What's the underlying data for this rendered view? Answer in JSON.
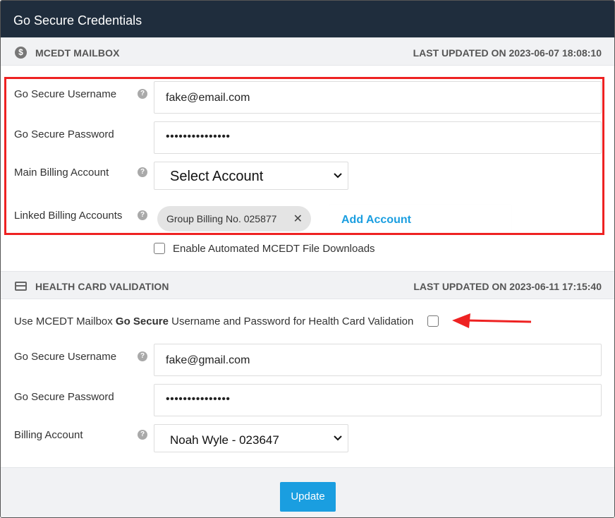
{
  "window": {
    "title": "Go Secure Credentials"
  },
  "mcedt": {
    "section_title": "MCEDT MAILBOX",
    "last_updated": "LAST UPDATED ON 2023-06-07 18:08:10",
    "username_label": "Go Secure Username",
    "username_value": "fake@email.com",
    "password_label": "Go Secure Password",
    "password_value": "•••••••••••••••",
    "main_billing_label": "Main Billing Account",
    "main_billing_selected": "Select Account",
    "linked_label": "Linked Billing Accounts",
    "linked_chips": [
      "Group Billing No. 025877"
    ],
    "add_account_label": "Add Account",
    "auto_download_label": "Enable Automated MCEDT File Downloads",
    "auto_download_checked": false
  },
  "health_card": {
    "section_title": "HEALTH CARD VALIDATION",
    "last_updated": "LAST UPDATED ON 2023-06-11 17:15:40",
    "use_mcedt_prefix": "Use MCEDT Mailbox ",
    "use_mcedt_bold": "Go Secure",
    "use_mcedt_suffix": " Username and Password for Health Card Validation",
    "use_mcedt_checked": false,
    "username_label": "Go Secure Username",
    "username_value": "fake@gmail.com",
    "password_label": "Go Secure Password",
    "password_value": "•••••••••••••••",
    "billing_label": "Billing Account",
    "billing_selected": "Noah Wyle - 023647"
  },
  "footer": {
    "update_label": "Update"
  },
  "icons": {
    "help": "?",
    "chip_remove": "✕",
    "dollar": "$"
  },
  "colors": {
    "header_bg": "#1f2d3d",
    "accent": "#1a9ee0",
    "annotation_red": "#ee2222"
  }
}
